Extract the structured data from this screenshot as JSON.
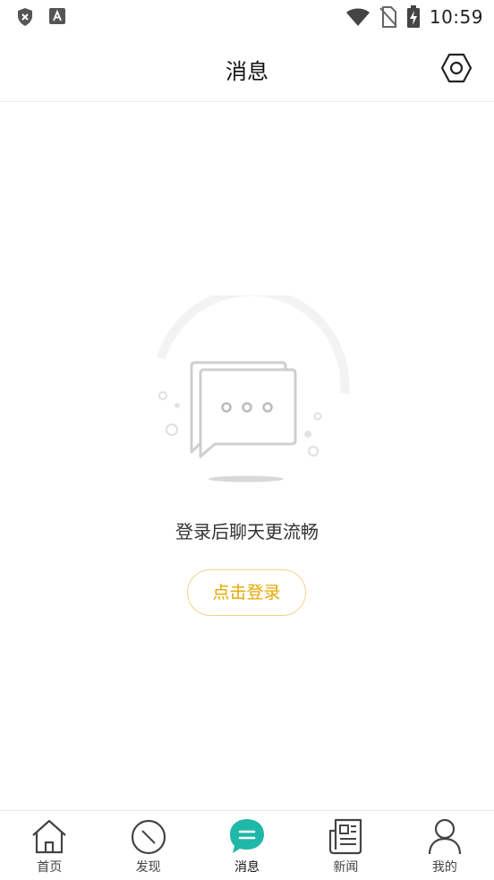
{
  "status_bar": {
    "time": "10:59",
    "left_icons": [
      "shield-x-icon",
      "a-notification-icon"
    ],
    "right_icons": [
      "wifi-icon",
      "no-sim-icon",
      "battery-charging-icon"
    ]
  },
  "header": {
    "title": "消息",
    "settings_icon": "gear-icon"
  },
  "empty_state": {
    "illustration_icon": "chat-bubbles-icon",
    "message": "登录后聊天更流畅",
    "login_label": "点击登录"
  },
  "tabs": [
    {
      "label": "首页",
      "icon": "home-icon",
      "active": false
    },
    {
      "label": "发现",
      "icon": "compass-icon",
      "active": false
    },
    {
      "label": "消息",
      "icon": "message-icon",
      "active": true
    },
    {
      "label": "新闻",
      "icon": "news-icon",
      "active": false
    },
    {
      "label": "我的",
      "icon": "profile-icon",
      "active": false
    }
  ],
  "colors": {
    "accent": "#1fb8a8",
    "login_text": "#e6a700",
    "login_border": "#f0d48a"
  }
}
